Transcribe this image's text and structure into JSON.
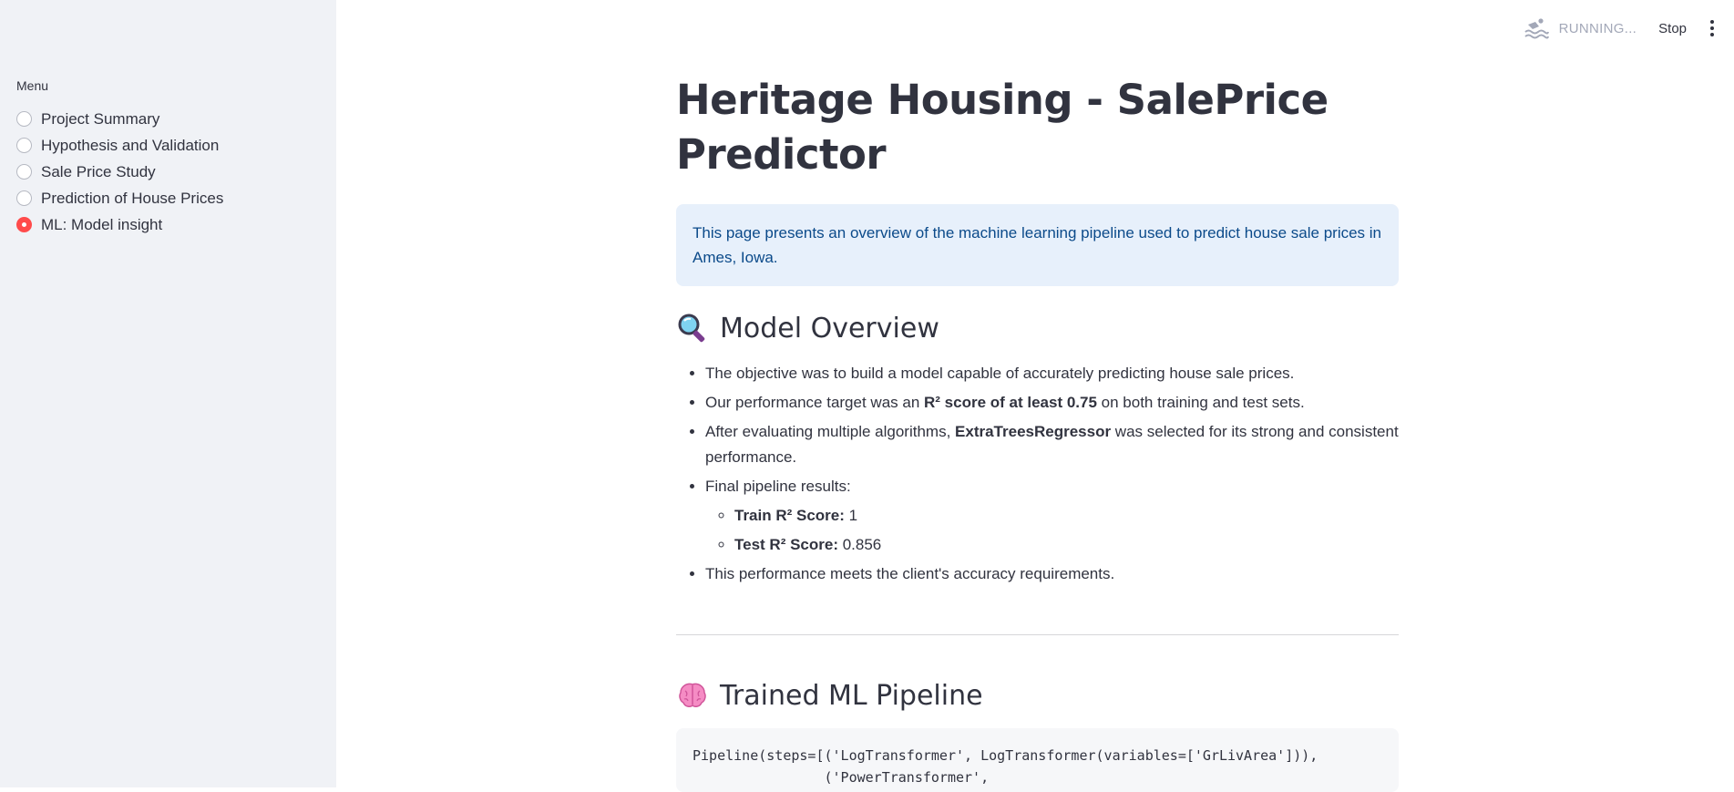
{
  "sidebar": {
    "menu_label": "Menu",
    "items": [
      {
        "label": "Project Summary",
        "selected": false
      },
      {
        "label": "Hypothesis and Validation",
        "selected": false
      },
      {
        "label": "Sale Price Study",
        "selected": false
      },
      {
        "label": "Prediction of House Prices",
        "selected": false
      },
      {
        "label": "ML: Model insight",
        "selected": true
      }
    ],
    "accent_color": "#ff4b4b"
  },
  "header": {
    "status_icon": "swimmer-icon",
    "status_text": "RUNNING...",
    "stop_label": "Stop",
    "menu_icon": "kebab-menu-icon"
  },
  "main": {
    "title": "Heritage Housing - SalePrice Predictor",
    "info_text": "This page presents an overview of the machine learning pipeline used to predict house sale prices in Ames, Iowa.",
    "overview": {
      "icon": "magnifier-icon",
      "heading": "Model Overview",
      "b1": "The objective was to build a model capable of accurately predicting house sale prices.",
      "b2_pre": "Our performance target was an ",
      "b2_bold": "R² score of at least 0.75",
      "b2_post": " on both training and test sets.",
      "b3_pre": "After evaluating multiple algorithms, ",
      "b3_bold": "ExtraTreesRegressor",
      "b3_post": " was selected for its strong and consistent performance.",
      "b4": "Final pipeline results:",
      "train_label": "Train R² Score:",
      "train_value": " 1",
      "test_label": "Test R² Score:",
      "test_value": " 0.856",
      "b5": "This performance meets the client's accuracy requirements."
    },
    "pipeline": {
      "icon": "brain-icon",
      "heading": "Trained ML Pipeline",
      "code": "Pipeline(steps=[('LogTransformer', LogTransformer(variables=['GrLivArea'])),\n                ('PowerTransformer',"
    }
  }
}
